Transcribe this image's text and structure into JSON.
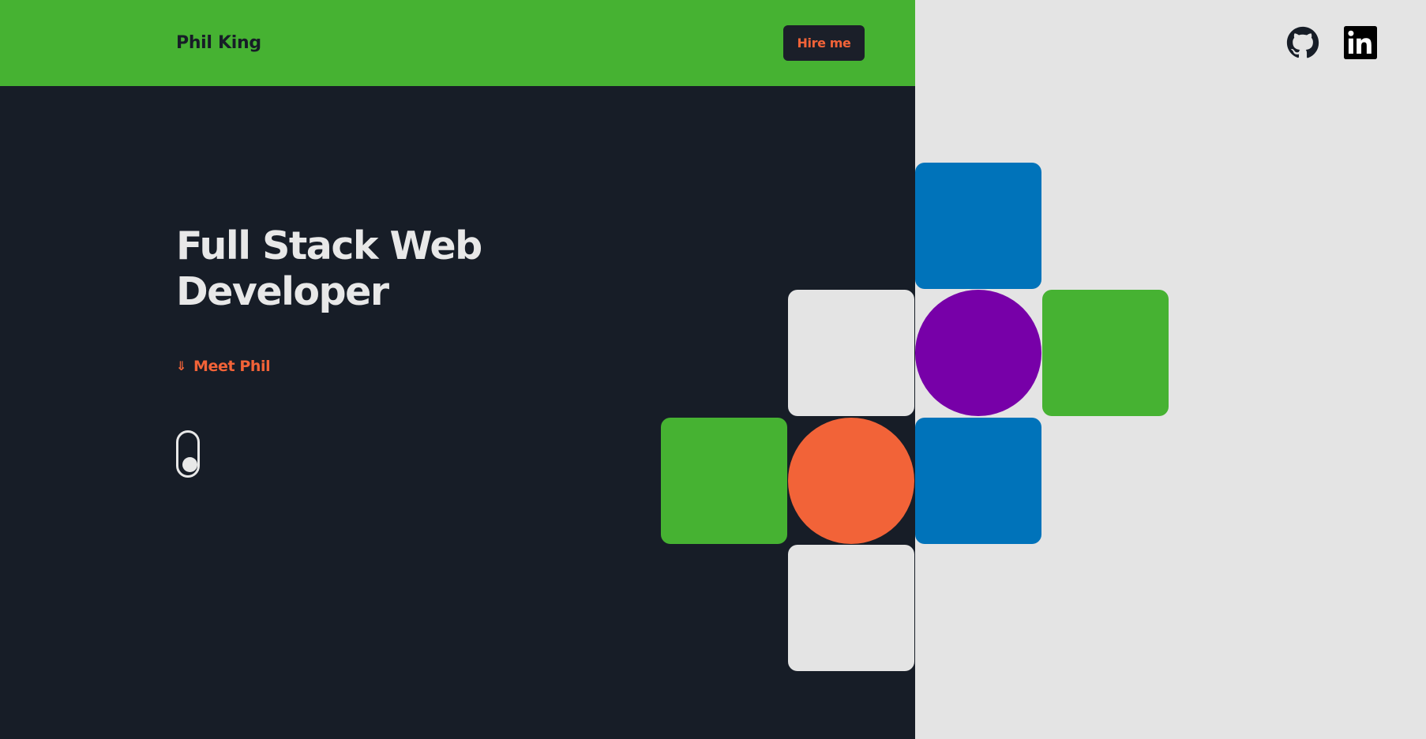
{
  "header": {
    "brand": "Phil King",
    "hire_label": "Hire me"
  },
  "social": [
    {
      "icon": "github-icon"
    },
    {
      "icon": "linkedin-icon"
    }
  ],
  "hero": {
    "title_line1": "Full Stack Web",
    "title_line2": "Developer",
    "meet_arrow": "⇓",
    "meet_label": "Meet Phil"
  },
  "colors": {
    "green": "#46b232",
    "dark": "#171d27",
    "light": "#e4e4e4",
    "blue": "#0073ba",
    "purple": "#7700a8",
    "orange": "#f26338"
  }
}
